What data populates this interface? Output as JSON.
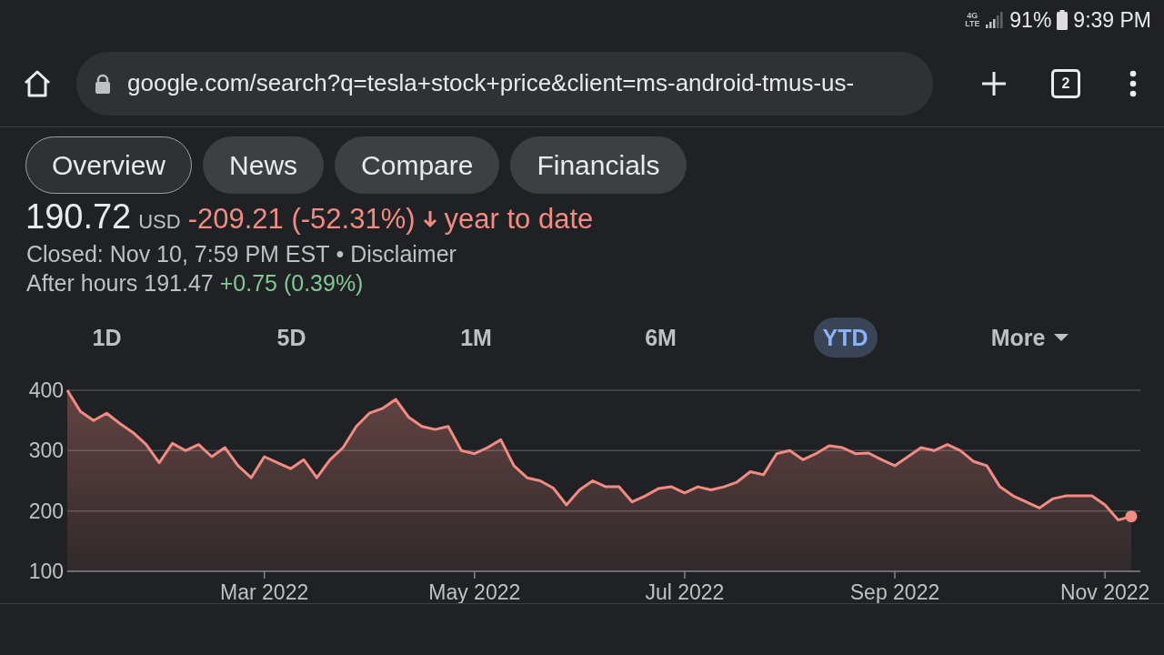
{
  "status_bar": {
    "network": "4G LTE",
    "battery": "91%",
    "time": "9:39 PM"
  },
  "browser": {
    "url": "google.com/search?q=tesla+stock+price&client=ms-android-tmus-us-",
    "tab_count": "2"
  },
  "tabs": [
    {
      "label": "Overview",
      "selected": true
    },
    {
      "label": "News",
      "selected": false
    },
    {
      "label": "Compare",
      "selected": false
    },
    {
      "label": "Financials",
      "selected": false
    }
  ],
  "quote": {
    "price": "190.72",
    "currency": "USD",
    "change": "-209.21 (-52.31%)",
    "falling": true,
    "period": "year to date"
  },
  "closed": {
    "text": "Closed: Nov 10, 7:59 PM EST",
    "separator": "•",
    "link": "Disclaimer"
  },
  "after_hours": {
    "label": "After hours 191.47",
    "change": "+0.75 (0.39%)"
  },
  "ranges": [
    {
      "label": "1D",
      "selected": false
    },
    {
      "label": "5D",
      "selected": false
    },
    {
      "label": "1M",
      "selected": false
    },
    {
      "label": "6M",
      "selected": false
    },
    {
      "label": "YTD",
      "selected": true
    },
    {
      "label": "More",
      "selected": false,
      "kind": "dropdown"
    }
  ],
  "chart": {
    "chart_data": {
      "type": "area",
      "ylim": [
        100,
        400
      ],
      "yticks": [
        100,
        200,
        300,
        400
      ],
      "categories": [
        null,
        null,
        null,
        null,
        null,
        null,
        null,
        null,
        null,
        null,
        null,
        null,
        null,
        null,
        null,
        "Mar 2022",
        null,
        null,
        null,
        null,
        null,
        null,
        null,
        null,
        null,
        null,
        null,
        null,
        null,
        null,
        null,
        "May 2022",
        null,
        null,
        null,
        null,
        null,
        null,
        null,
        null,
        null,
        null,
        null,
        null,
        null,
        null,
        null,
        "Jul 2022",
        null,
        null,
        null,
        null,
        null,
        null,
        null,
        null,
        null,
        null,
        null,
        null,
        null,
        null,
        null,
        "Sep 2022",
        null,
        null,
        null,
        null,
        null,
        null,
        null,
        null,
        null,
        null,
        null,
        null,
        null,
        null,
        null,
        "Nov 2022",
        null,
        null
      ],
      "series": [
        {
          "color": "#f28b82",
          "values": [
            400,
            365,
            350,
            362,
            345,
            330,
            310,
            280,
            312,
            300,
            310,
            290,
            305,
            275,
            255,
            290,
            280,
            270,
            285,
            255,
            285,
            305,
            340,
            362,
            370,
            385,
            355,
            340,
            335,
            340,
            300,
            295,
            305,
            318,
            275,
            255,
            250,
            238,
            210,
            235,
            250,
            240,
            240,
            215,
            225,
            237,
            240,
            230,
            240,
            235,
            240,
            248,
            265,
            260,
            295,
            300,
            285,
            295,
            308,
            305,
            295,
            296,
            285,
            275,
            290,
            305,
            300,
            310,
            300,
            282,
            275,
            240,
            225,
            215,
            205,
            220,
            225,
            225,
            225,
            210,
            185,
            191
          ]
        }
      ]
    }
  }
}
